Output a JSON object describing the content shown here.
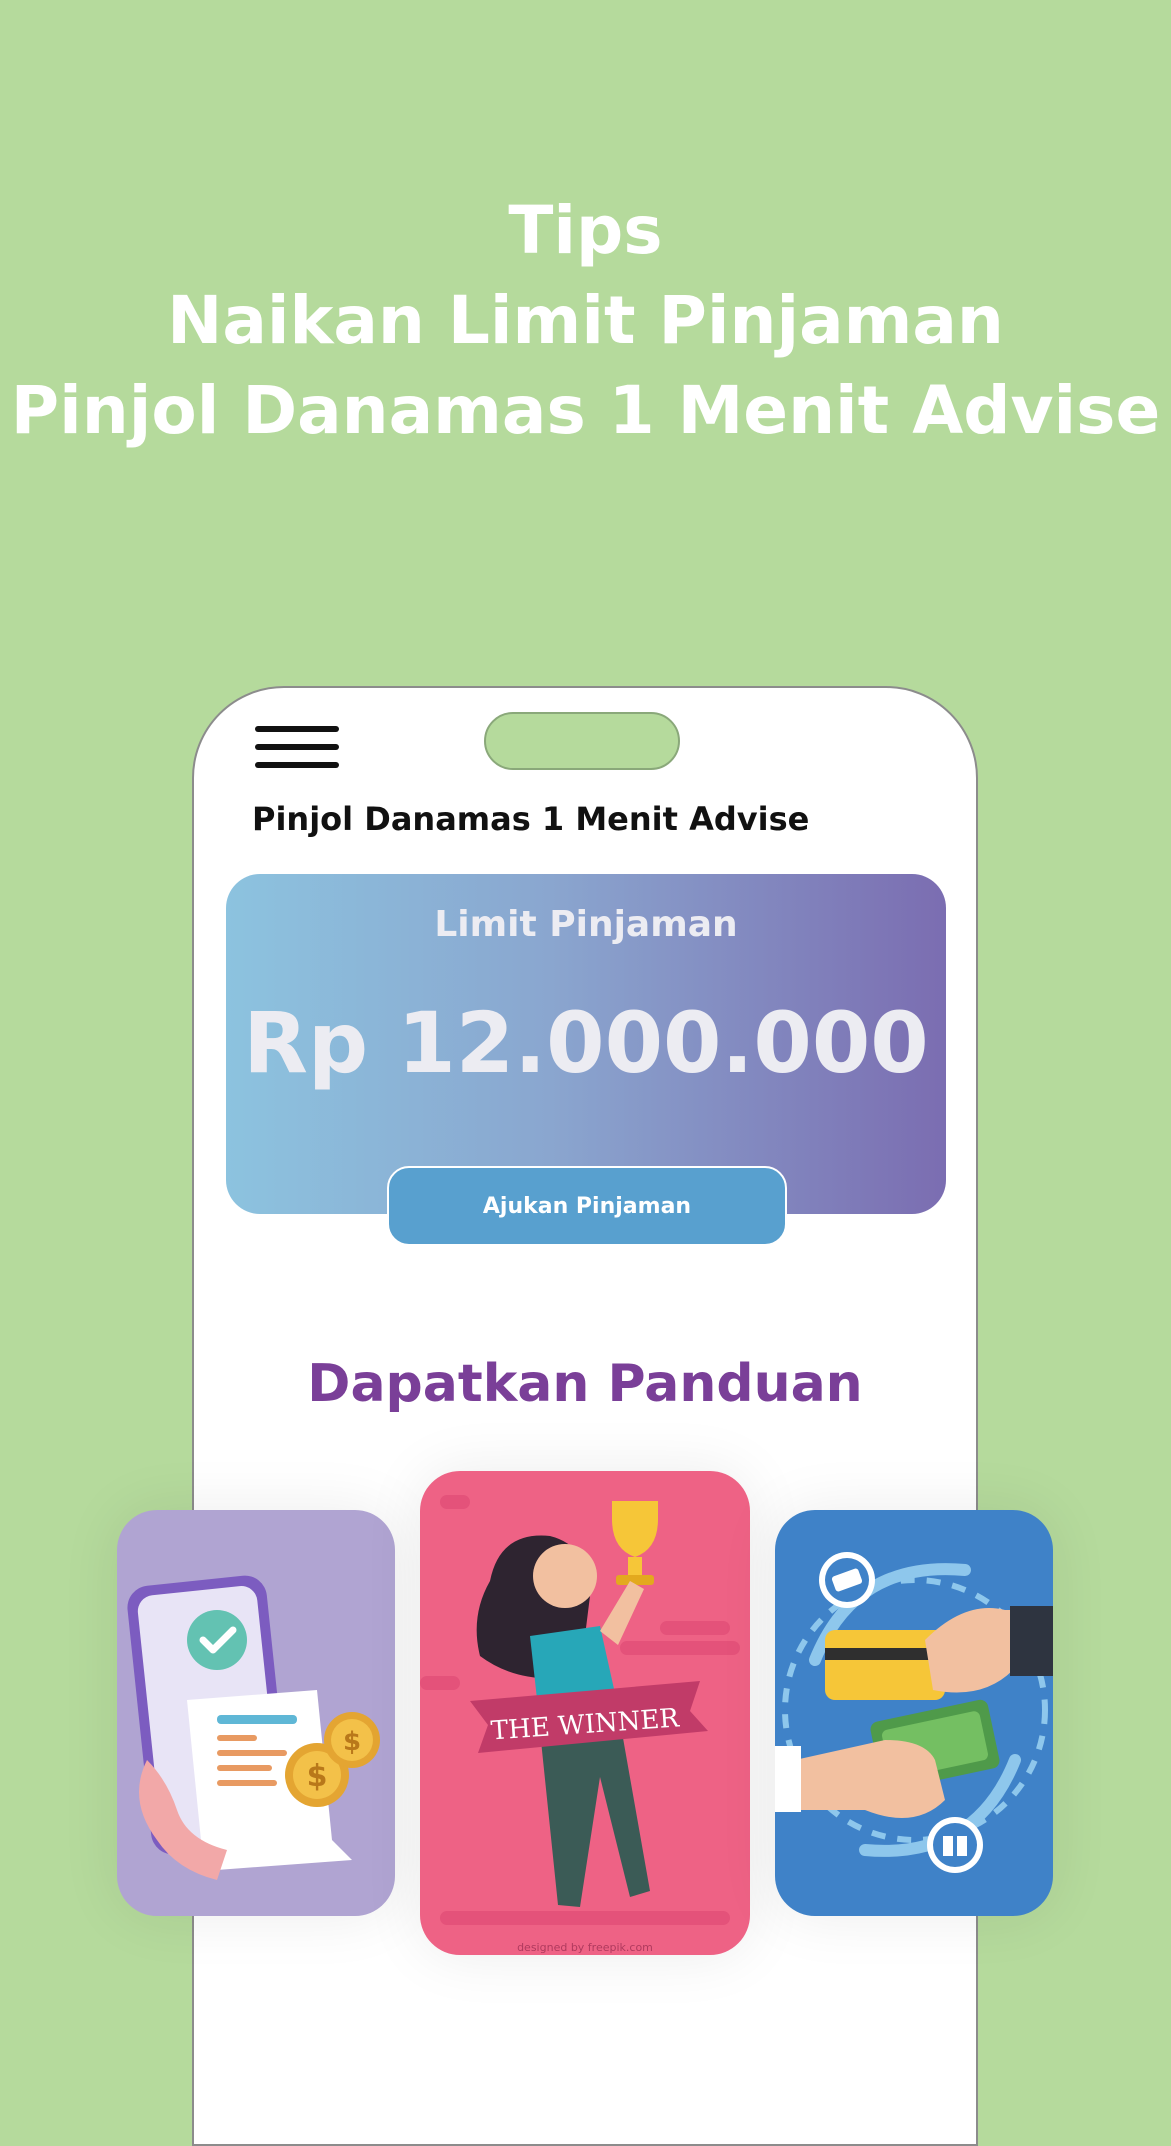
{
  "headline": {
    "line1": "Tips",
    "line2": "Naikan Limit Pinjaman",
    "line3": "Pinjol Danamas 1 Menit Advise"
  },
  "app": {
    "title": "Pinjol Danamas 1 Menit Advise"
  },
  "limit_card": {
    "label": "Limit Pinjaman",
    "amount": "Rp 12.000.000"
  },
  "apply_button": {
    "label": "Ajukan Pinjaman"
  },
  "guide": {
    "heading": "Dapatkan Panduan"
  },
  "cards": {
    "middle_banner": "THE WINNER",
    "middle_credit": "designed by freepik.com"
  },
  "icons": {
    "menu": "menu-icon",
    "check": "check-icon",
    "dollar": "dollar-coin-icon",
    "trophy": "trophy-icon",
    "money": "money-icon",
    "gift": "gift-icon"
  },
  "colors": {
    "background": "#b5da9c",
    "card_gradient_start": "#8cc3df",
    "card_gradient_end": "#7b6db1",
    "button": "#58a0cf",
    "heading_purple": "#7a3f98",
    "card_left": "#b0a4d2",
    "card_middle": "#ee6285",
    "card_right": "#3f82c8"
  }
}
